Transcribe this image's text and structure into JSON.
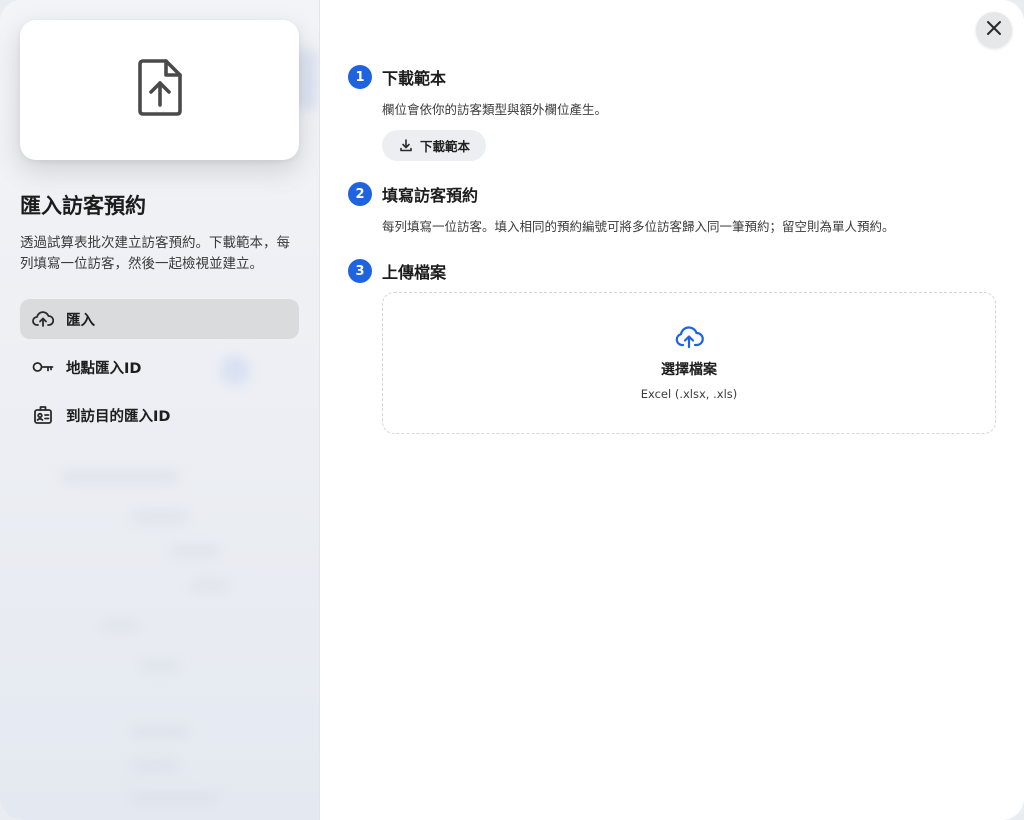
{
  "sidebar": {
    "title": "匯入訪客預約",
    "description": "透過試算表批次建立訪客預約。下載範本，每列填寫一位訪客，然後一起檢視並建立。",
    "hero_icon": "file-upload-icon",
    "nav": [
      {
        "label": "匯入",
        "icon": "cloud-upload-icon",
        "active": true
      },
      {
        "label": "地點匯入ID",
        "icon": "key-icon",
        "active": false
      },
      {
        "label": "到訪目的匯入ID",
        "icon": "badge-icon",
        "active": false
      }
    ]
  },
  "steps": [
    {
      "number": "1",
      "title": "下載範本",
      "description": "欄位會依你的訪客類型與額外欄位產生。",
      "button_label": "下載範本"
    },
    {
      "number": "2",
      "title": "填寫訪客預約",
      "description": "每列填寫一位訪客。填入相同的預約編號可將多位訪客歸入同一筆預約；留空則為單人預約。"
    },
    {
      "number": "3",
      "title": "上傳檔案"
    }
  ],
  "dropzone": {
    "title": "選擇檔案",
    "subtitle": "Excel (.xlsx, .xls)",
    "icon": "cloud-upload-icon"
  },
  "close_icon": "close-icon",
  "colors": {
    "accent": "#1f63e0",
    "active_nav_bg": "#dadbdd",
    "sidebar_bg": "#eff1f5"
  }
}
